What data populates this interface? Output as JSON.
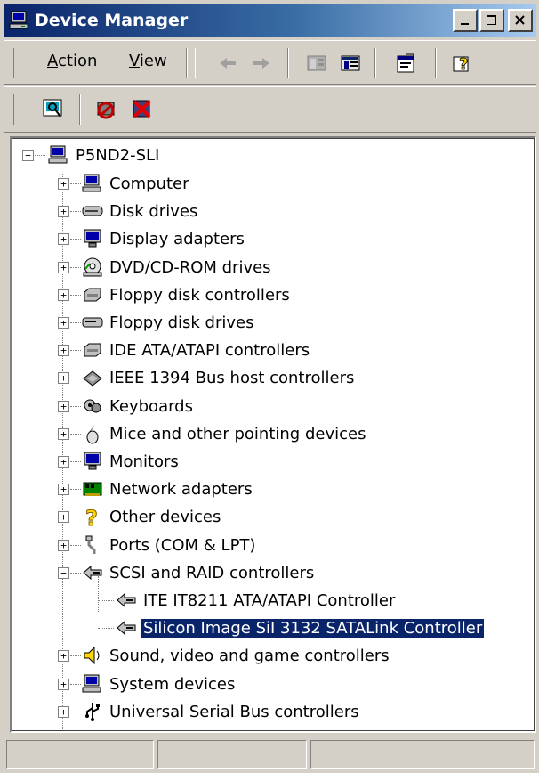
{
  "window": {
    "title": "Device Manager",
    "buttons": {
      "minimize": "_",
      "maximize": "□",
      "close": "×"
    }
  },
  "menu": {
    "action": "Action",
    "view": "View"
  },
  "toolbar": {
    "icons": [
      "back-arrow-icon",
      "forward-arrow-icon",
      "show-hide-tree-icon",
      "export-list-icon",
      "properties-icon",
      "help-icon"
    ]
  },
  "toolbar2": {
    "icons": [
      "scan-hardware-icon",
      "disable-device-icon",
      "uninstall-device-icon"
    ]
  },
  "tree": {
    "root": "P5ND2-SLI",
    "items": [
      {
        "label": "Computer",
        "icon": "computer-icon",
        "expanded": false
      },
      {
        "label": "Disk drives",
        "icon": "disk-drive-icon",
        "expanded": false
      },
      {
        "label": "Display adapters",
        "icon": "monitor-icon",
        "expanded": false
      },
      {
        "label": "DVD/CD-ROM drives",
        "icon": "cdrom-icon",
        "expanded": false
      },
      {
        "label": "Floppy disk controllers",
        "icon": "controller-icon",
        "expanded": false
      },
      {
        "label": "Floppy disk drives",
        "icon": "floppy-drive-icon",
        "expanded": false
      },
      {
        "label": "IDE ATA/ATAPI controllers",
        "icon": "controller-icon",
        "expanded": false
      },
      {
        "label": "IEEE 1394 Bus host controllers",
        "icon": "ieee1394-icon",
        "expanded": false
      },
      {
        "label": "Keyboards",
        "icon": "keyboard-icon",
        "expanded": false
      },
      {
        "label": "Mice and other pointing devices",
        "icon": "mouse-icon",
        "expanded": false
      },
      {
        "label": "Monitors",
        "icon": "monitor-icon",
        "expanded": false
      },
      {
        "label": "Network adapters",
        "icon": "network-card-icon",
        "expanded": false
      },
      {
        "label": "Other devices",
        "icon": "question-mark-icon",
        "expanded": false
      },
      {
        "label": "Ports (COM & LPT)",
        "icon": "port-icon",
        "expanded": false
      },
      {
        "label": "SCSI and RAID controllers",
        "icon": "scsi-icon",
        "expanded": true,
        "children": [
          {
            "label": "ITE IT8211 ATA/ATAPI Controller",
            "icon": "scsi-icon",
            "selected": false
          },
          {
            "label": "Silicon Image SiI 3132 SATALink Controller",
            "icon": "scsi-icon",
            "selected": true
          }
        ]
      },
      {
        "label": "Sound, video and game controllers",
        "icon": "speaker-icon",
        "expanded": false
      },
      {
        "label": "System devices",
        "icon": "computer-icon",
        "expanded": false
      },
      {
        "label": "Universal Serial Bus controllers",
        "icon": "usb-icon",
        "expanded": false
      }
    ]
  },
  "colors": {
    "selection": "#0a246a",
    "titlebar_start": "#0a246a",
    "titlebar_end": "#a6caf0",
    "chrome": "#d4d0c8"
  }
}
